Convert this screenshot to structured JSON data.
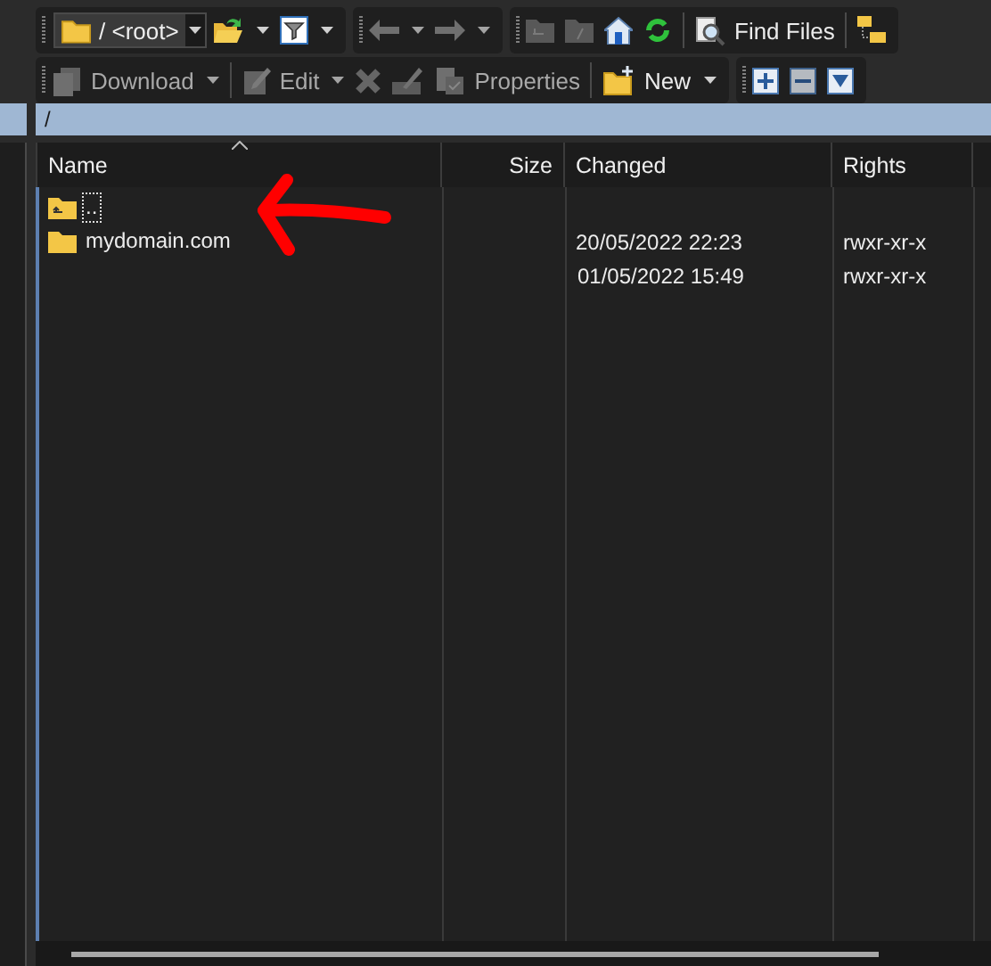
{
  "toolbars": [
    {
      "bands": [
        {
          "groups": [
            [
              {
                "kind": "combo",
                "value": "/ <root>",
                "dropdown": true
              },
              {
                "kind": "button",
                "disabled": false,
                "dropdown": true
              },
              {
                "kind": "button",
                "disabled": false,
                "dropdown": true
              }
            ]
          ]
        },
        {
          "groups": [
            [
              {
                "kind": "button",
                "disabled": true,
                "dropdown": true
              },
              {
                "kind": "button",
                "disabled": true,
                "dropdown": true
              }
            ]
          ]
        },
        {
          "groups": [
            [
              {
                "kind": "button",
                "disabled": true,
                "dropdown": false
              },
              {
                "kind": "button",
                "disabled": true,
                "dropdown": false
              },
              {
                "kind": "button",
                "disabled": false,
                "dropdown": false
              },
              {
                "kind": "button",
                "disabled": false,
                "dropdown": false
              }
            ],
            [
              {
                "kind": "button",
                "label": "Find Files",
                "disabled": false,
                "dropdown": false
              }
            ],
            [
              {
                "kind": "button",
                "disabled": false,
                "dropdown": false
              }
            ]
          ]
        }
      ]
    },
    {
      "bands": [
        {
          "groups": [
            [
              {
                "kind": "button",
                "label": "Download",
                "disabled": true,
                "dropdown": true
              }
            ],
            [
              {
                "kind": "button",
                "label": "Edit",
                "disabled": true,
                "dropdown": true
              },
              {
                "kind": "button",
                "disabled": true,
                "dropdown": false
              },
              {
                "kind": "button",
                "disabled": true,
                "dropdown": false
              },
              {
                "kind": "button",
                "label": "Properties",
                "disabled": true,
                "dropdown": false
              }
            ],
            [
              {
                "kind": "button",
                "label": "New",
                "disabled": false,
                "dropdown": true
              }
            ]
          ]
        },
        {
          "groups": [
            [
              {
                "kind": "button",
                "disabled": false,
                "dropdown": false
              },
              {
                "kind": "button",
                "disabled": true,
                "dropdown": false
              },
              {
                "kind": "button",
                "disabled": false,
                "dropdown": false
              }
            ]
          ]
        }
      ]
    }
  ],
  "path_bar": {
    "path": "/"
  },
  "file_list": {
    "columns": [
      {
        "label": "Name",
        "sorted": true
      },
      {
        "label": "Size",
        "sorted": false
      },
      {
        "label": "Changed",
        "sorted": false
      },
      {
        "label": "Rights",
        "sorted": false
      }
    ],
    "rows": [
      {
        "kind": "parent",
        "name": "..",
        "size": "",
        "changed": "",
        "rights": "",
        "focused": true
      },
      {
        "kind": "folder",
        "name": "mydomain.com",
        "changed": "20/05/2022 22:23",
        "rights": "rwxr-xr-x",
        "focused": false
      },
      {
        "kind": "blank",
        "changed": "01/05/2022 15:49",
        "rights": "rwxr-xr-x",
        "focused": false
      }
    ]
  },
  "annotations": [
    {
      "kind": "arrow",
      "color": "#ff0000"
    }
  ]
}
